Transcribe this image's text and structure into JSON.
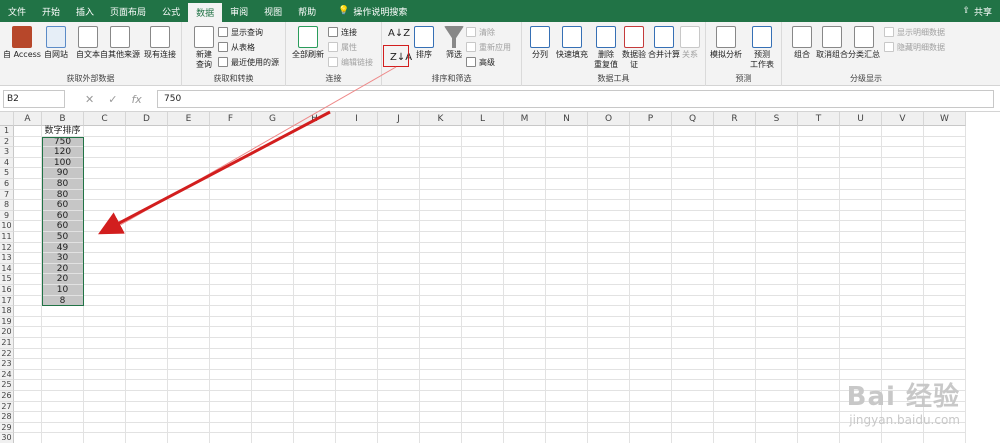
{
  "tabs": [
    "文件",
    "开始",
    "插入",
    "页面布局",
    "公式",
    "数据",
    "审阅",
    "视图",
    "帮助"
  ],
  "active_tab": "数据",
  "search_label": "操作说明搜索",
  "share_label": "共享",
  "groups": {
    "external": {
      "label": "获取外部数据",
      "buttons": [
        "自 Access",
        "自网站",
        "自文本",
        "自其他来源",
        "现有连接"
      ]
    },
    "transform": {
      "label": "获取和转换",
      "new_query": "新建\n查询",
      "small": [
        "显示查询",
        "从表格",
        "最近使用的源"
      ]
    },
    "connections": {
      "label": "连接",
      "refresh_all": "全部刷新",
      "small": [
        "连接",
        "属性",
        "编辑链接"
      ]
    },
    "sort_filter": {
      "label": "排序和筛选",
      "sort": "排序",
      "filter": "筛选",
      "small": [
        "清除",
        "重新应用",
        "高级"
      ]
    },
    "data_tools": {
      "label": "数据工具",
      "buttons": [
        "分列",
        "快速填充",
        "删除\n重复值",
        "数据验\n证",
        "合并计算",
        "关系"
      ]
    },
    "forecast": {
      "label": "预测",
      "buttons": [
        "模拟分析",
        "预测\n工作表"
      ]
    },
    "outline": {
      "label": "分级显示",
      "buttons": [
        "组合",
        "取消组合",
        "分类汇总"
      ],
      "small": [
        "显示明细数据",
        "隐藏明细数据"
      ]
    }
  },
  "name_box": "B2",
  "formula_value": "750",
  "columns": [
    "A",
    "B",
    "C",
    "D",
    "E",
    "F",
    "G",
    "H",
    "I",
    "J",
    "K",
    "L",
    "M",
    "N",
    "O",
    "P",
    "Q",
    "R",
    "S",
    "T",
    "U",
    "V",
    "W"
  ],
  "rows": [
    "1",
    "2",
    "3",
    "4",
    "5",
    "6",
    "7",
    "8",
    "9",
    "10",
    "11",
    "12",
    "13",
    "14",
    "15",
    "16",
    "17",
    "18",
    "19",
    "20",
    "21",
    "22",
    "23",
    "24",
    "25",
    "26",
    "27",
    "28",
    "29",
    "30"
  ],
  "column_b": [
    "数字排序",
    "750",
    "120",
    "100",
    "90",
    "80",
    "80",
    "60",
    "60",
    "60",
    "50",
    "49",
    "30",
    "20",
    "20",
    "10",
    "8"
  ],
  "watermark": {
    "big": "Bai 经验",
    "small": "jingyan.baidu.com"
  }
}
